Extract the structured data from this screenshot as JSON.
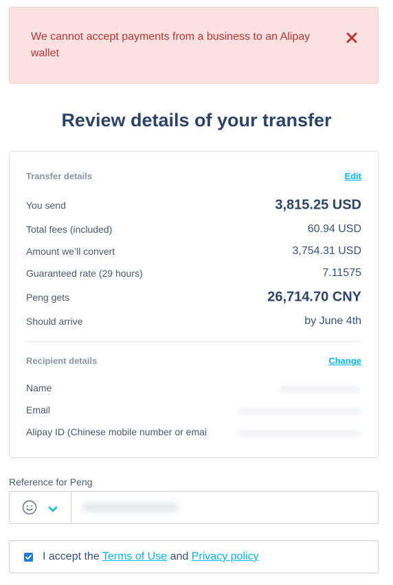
{
  "alert": {
    "message": "We cannot accept payments from a business to an Alipay wallet",
    "close_icon": "close-icon",
    "color": "#c33131",
    "background": "#fbe1e1"
  },
  "title": "Review details of your transfer",
  "transfer": {
    "section_title": "Transfer details",
    "edit_label": "Edit",
    "rows": [
      {
        "label": "You send",
        "value": "3,815.25 USD"
      },
      {
        "label": "Total fees (included)",
        "value": "60.94 USD"
      },
      {
        "label": "Amount we’ll convert",
        "value": "3,754.31 USD"
      },
      {
        "label": "Guaranteed rate (29 hours)",
        "value": "7.11575"
      },
      {
        "label": "Peng gets",
        "value": "26,714.70 CNY"
      },
      {
        "label": "Should arrive",
        "value": "by June 4th"
      }
    ]
  },
  "recipient": {
    "section_title": "Recipient details",
    "change_label": "Change",
    "rows": [
      {
        "label": "Name"
      },
      {
        "label": "Email"
      },
      {
        "label": "Alipay ID (Chinese mobile number or email)"
      }
    ]
  },
  "reference": {
    "label": "Reference for Peng",
    "emoji_icon": "smiley-icon",
    "dropdown_icon": "chevron-down-icon",
    "placeholder": ""
  },
  "terms": {
    "checked": true,
    "prefix": "I accept the",
    "terms_link": "Terms of Use",
    "conjunction": "and",
    "privacy_link": "Privacy policy"
  },
  "colors": {
    "accent": "#00b9ff",
    "heading": "#2e4369",
    "checkbox": "#1f7ce6"
  }
}
